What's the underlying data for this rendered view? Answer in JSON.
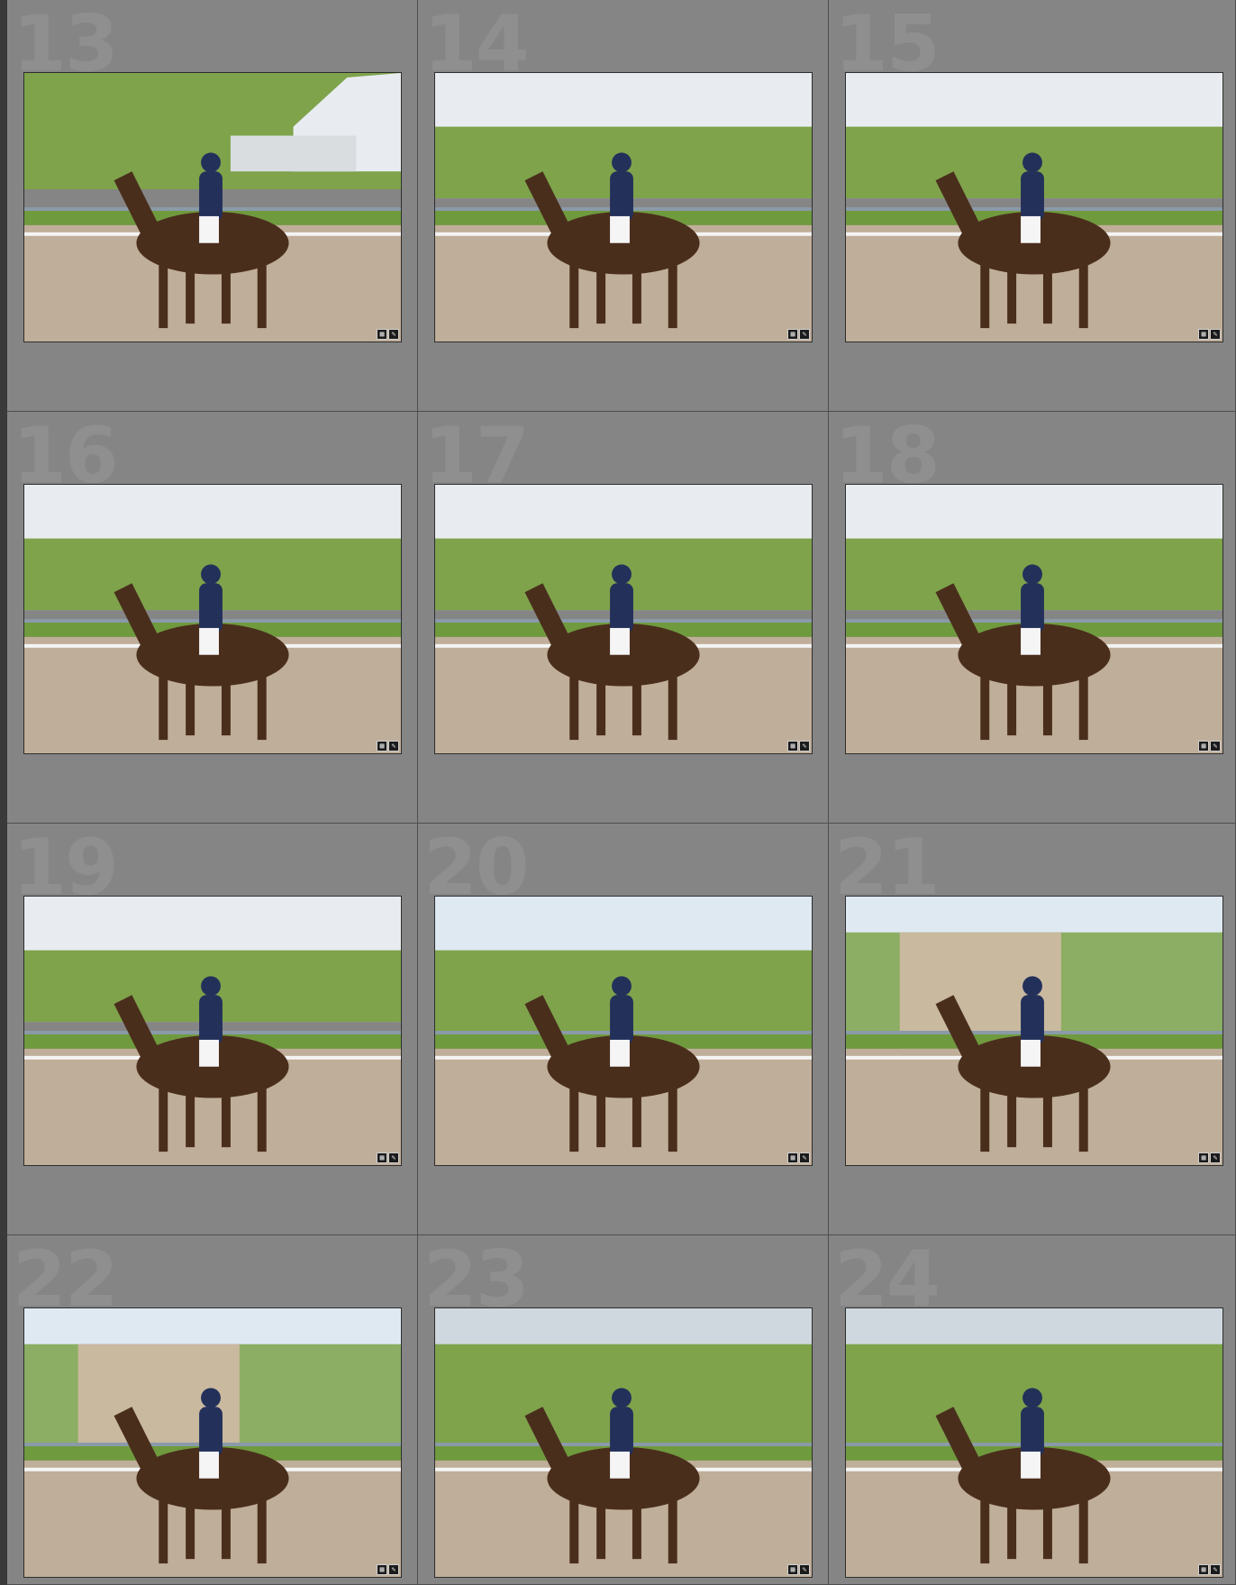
{
  "grid": {
    "cells": [
      {
        "index": "13",
        "scene": "tents"
      },
      {
        "index": "14",
        "scene": "hedge"
      },
      {
        "index": "15",
        "scene": "hedge"
      },
      {
        "index": "16",
        "scene": "hedge"
      },
      {
        "index": "17",
        "scene": "hedge"
      },
      {
        "index": "18",
        "scene": "hedge"
      },
      {
        "index": "19",
        "scene": "hedge"
      },
      {
        "index": "20",
        "scene": "open"
      },
      {
        "index": "21",
        "scene": "booth"
      },
      {
        "index": "22",
        "scene": "booth"
      },
      {
        "index": "23",
        "scene": "trees"
      },
      {
        "index": "24",
        "scene": "trees"
      }
    ]
  },
  "colors": {
    "sand": "#bfae99",
    "grass": "#6f9a3e",
    "foliage": "#7ea34b",
    "tent": "#e8ecf0",
    "sky": "#dfe9f2",
    "horse": "#4a2e1c",
    "rider": "#23305a",
    "fence": "#8a9aa8"
  },
  "icons": {
    "badge_left": "crop-icon",
    "badge_right": "edit-icon"
  }
}
